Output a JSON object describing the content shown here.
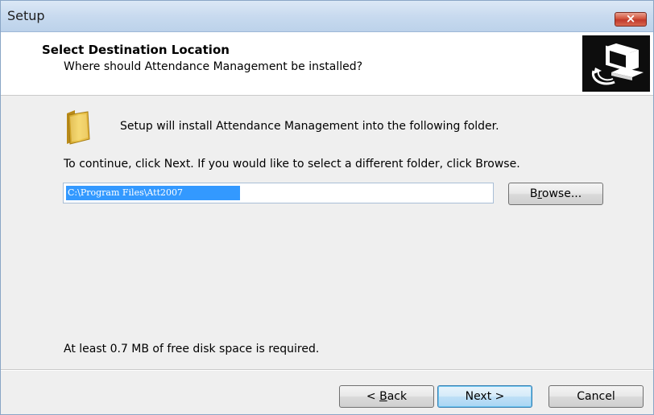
{
  "window": {
    "title": "Setup"
  },
  "header": {
    "title": "Select Destination Location",
    "subtitle": "Where should Attendance Management be installed?"
  },
  "content": {
    "install_message": "Setup will install Attendance Management into the following folder.",
    "continue_message": "To continue, click Next. If you would like to select a different folder, click Browse.",
    "path_value": "C:\\Program Files\\Att2007",
    "disk_space_message": "At least 0.7 MB of free disk space is required."
  },
  "buttons": {
    "browse": {
      "mnemonic": "r",
      "rest_before": "B",
      "rest_after": "owse..."
    },
    "back": {
      "prefix": "< ",
      "mnemonic": "B",
      "rest": "ack"
    },
    "next": "Next >",
    "cancel": "Cancel",
    "close": "×"
  },
  "icons": {
    "folder": "folder-icon",
    "header_image": "computer-install-icon",
    "close": "close-icon"
  },
  "colors": {
    "selection": "#3399ff",
    "close_button": "#c0392b",
    "default_button_border": "#3c7fb1"
  }
}
